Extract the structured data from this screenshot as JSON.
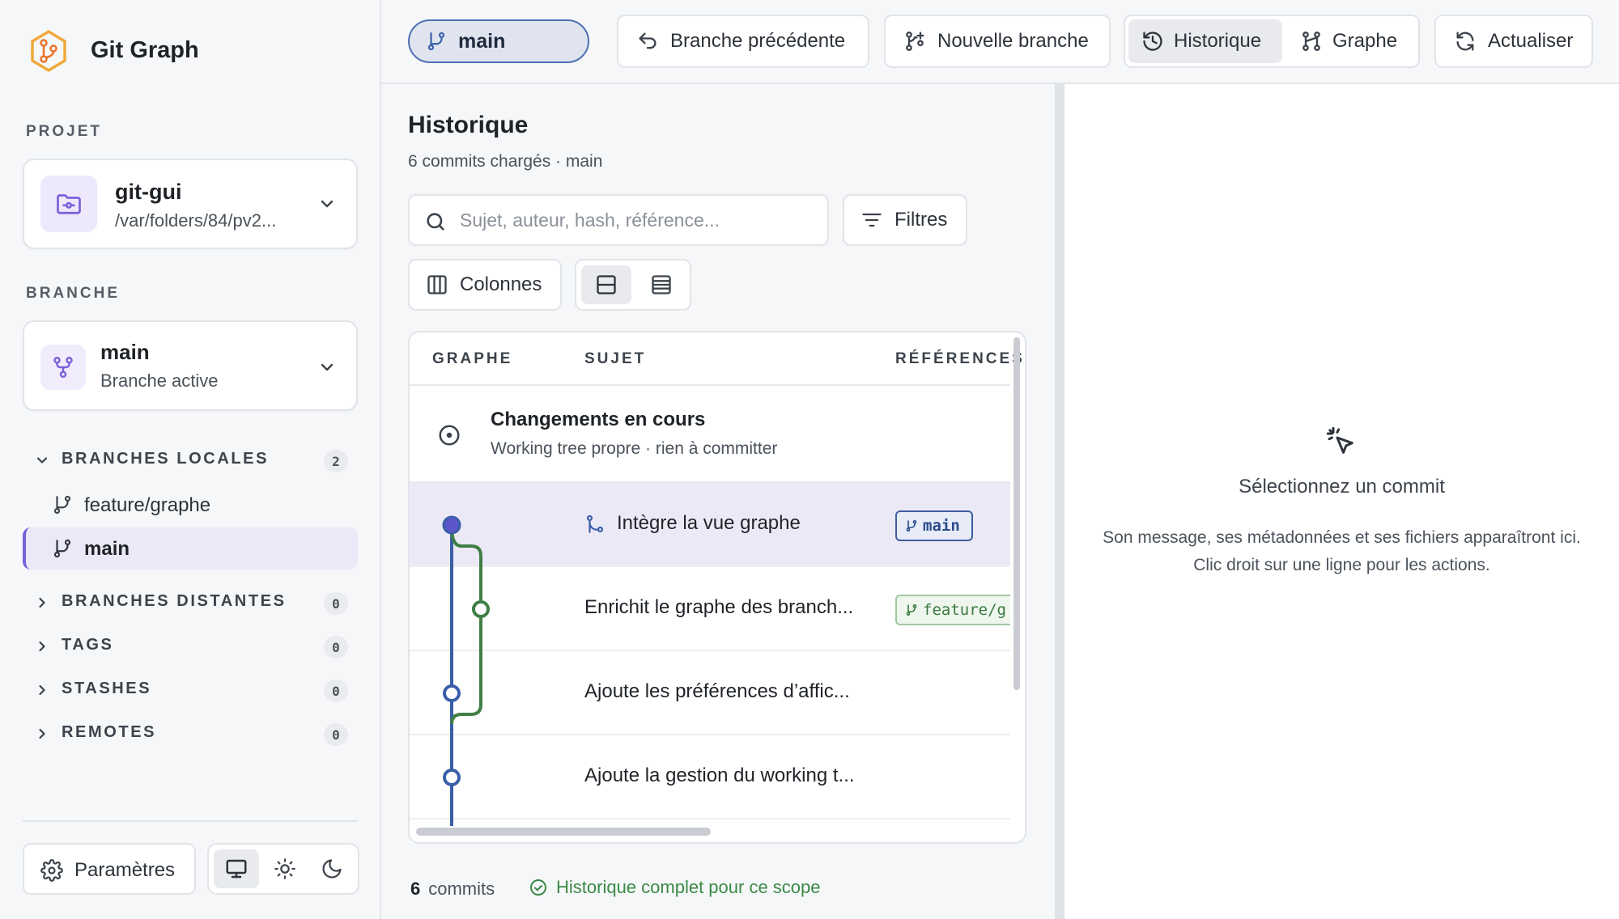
{
  "app": {
    "title": "Git Graph"
  },
  "sidebar": {
    "project_label": "PROJET",
    "project": {
      "name": "git-gui",
      "path": "/var/folders/84/pv2..."
    },
    "branch_label": "BRANCHE",
    "branch": {
      "name": "main",
      "status": "Branche active"
    },
    "sections": [
      {
        "label": "BRANCHES LOCALES",
        "count": "2",
        "expanded": true
      },
      {
        "label": "BRANCHES DISTANTES",
        "count": "0",
        "expanded": false
      },
      {
        "label": "TAGS",
        "count": "0",
        "expanded": false
      },
      {
        "label": "STASHES",
        "count": "0",
        "expanded": false
      },
      {
        "label": "REMOTES",
        "count": "0",
        "expanded": false
      }
    ],
    "local_branches": [
      {
        "name": "feature/graphe",
        "active": false
      },
      {
        "name": "main",
        "active": true
      }
    ],
    "settings_label": "Paramètres"
  },
  "toolbar": {
    "current_branch": "main",
    "previous_branch": "Branche précédente",
    "new_branch": "Nouvelle branche",
    "view_history": "Historique",
    "view_graph": "Graphe",
    "refresh": "Actualiser"
  },
  "history": {
    "title": "Historique",
    "subtitle": "6 commits chargés · main",
    "search_placeholder": "Sujet, auteur, hash, référence...",
    "filters_label": "Filtres",
    "columns_label": "Colonnes",
    "headers": {
      "graph": "GRAPHE",
      "subject": "SUJET",
      "refs": "RÉFÉRENCES"
    },
    "wip": {
      "title": "Changements en cours",
      "subtitle": "Working tree propre · rien à committer"
    },
    "commits": [
      {
        "subject": "Intègre la vue graphe",
        "ref": "main",
        "selected": true,
        "merge": true
      },
      {
        "subject": "Enrichit le graphe des branch...",
        "ref": "feature/g",
        "selected": false,
        "merge": false
      },
      {
        "subject": "Ajoute les préférences d’affic...",
        "ref": "",
        "selected": false,
        "merge": false
      },
      {
        "subject": "Ajoute la gestion du working t...",
        "ref": "",
        "selected": false,
        "merge": false
      }
    ],
    "footer": {
      "count": "6",
      "count_label": "commits",
      "status": "Historique complet pour ce scope"
    }
  },
  "detail": {
    "title": "Sélectionnez un commit",
    "body": "Son message, ses métadonnées et ses fichiers apparaîtront ici. Clic droit sur une ligne pour les actions."
  },
  "colors": {
    "accent": "#7b61d9",
    "main_lane": "#3a5fa8",
    "feature_lane": "#3f7f46",
    "success": "#3a8a45"
  }
}
